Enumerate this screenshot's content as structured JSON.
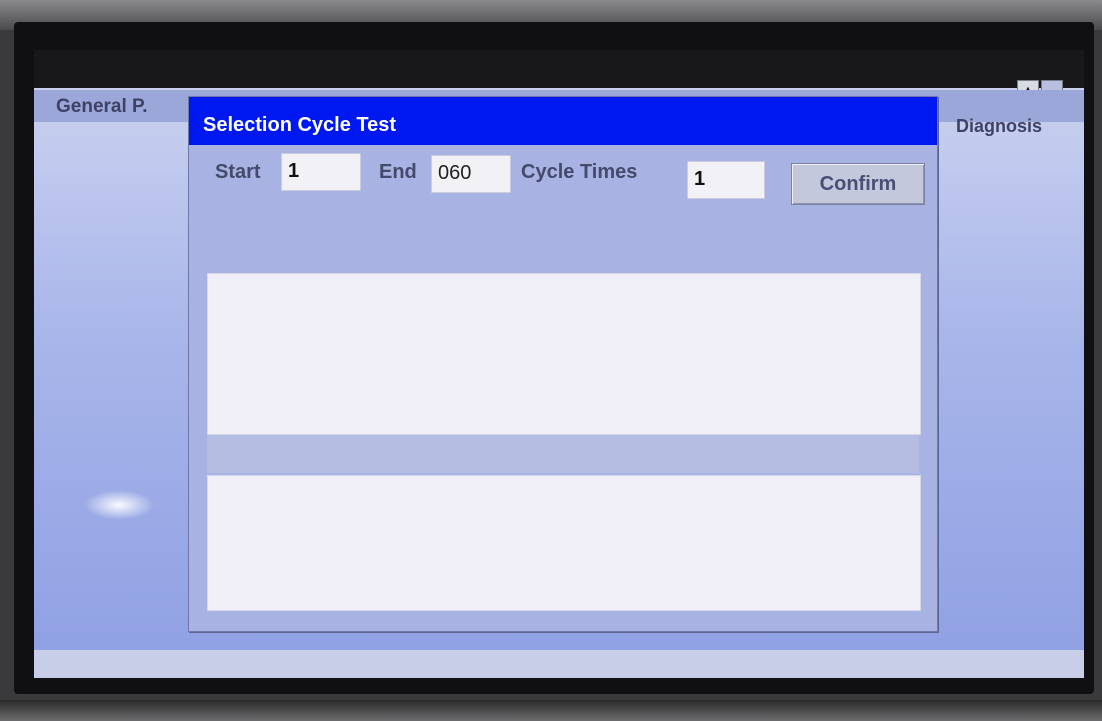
{
  "tabs": {
    "general": "General P.",
    "diagnosis": "Diagnosis"
  },
  "dialog": {
    "title": "Selection Cycle Test",
    "start_label": "Start",
    "start_value": "1",
    "end_label": "End",
    "end_value": "060",
    "cycle_label": "Cycle Times",
    "cycle_value": "1",
    "confirm_label": "Confirm"
  },
  "icons": {
    "scroll_up": "triangle-up-icon"
  },
  "colors": {
    "title_bar": "#0018f0",
    "dialog_bg": "#a8b3e3"
  }
}
